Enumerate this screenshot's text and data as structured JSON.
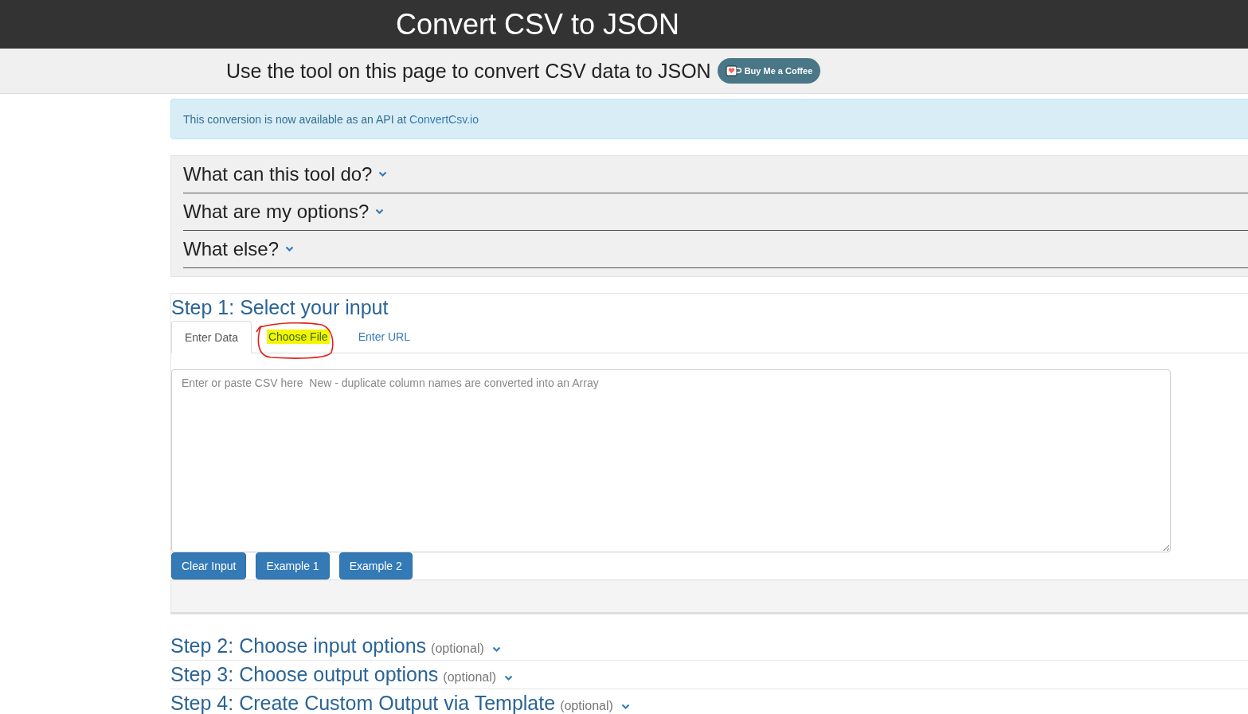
{
  "header": {
    "title": "Convert CSV to JSON"
  },
  "subheader": {
    "text": "Use the tool on this page to convert CSV data to JSON",
    "coffee_button": "Buy Me a Coffee"
  },
  "alert": {
    "text": "This conversion is now available as an API at",
    "link": "ConvertCsv.io"
  },
  "faq": [
    {
      "question": "What can this tool do?",
      "expanded": false
    },
    {
      "question": "What are my options?",
      "expanded": false
    },
    {
      "question": "What else?",
      "expanded": false
    }
  ],
  "step1": {
    "title": "Step 1: Select your input",
    "tabs": [
      {
        "label": "Enter Data",
        "selected": true,
        "highlighted": false
      },
      {
        "label": "Choose File",
        "selected": false,
        "highlighted": true
      },
      {
        "label": "Enter URL",
        "selected": false,
        "highlighted": false
      }
    ],
    "input": {
      "placeholder": "Enter or paste CSV here  New - duplicate column names are converted into an Array"
    },
    "buttons": [
      "Clear Input",
      "Example 1",
      "Example 2"
    ]
  },
  "steps": [
    {
      "title": "Step 2: Choose input options",
      "note": "(optional)",
      "expanded": false
    },
    {
      "title": "Step 3: Choose output options",
      "note": "(optional)",
      "expanded": false
    },
    {
      "title": "Step 4: Create Custom Output via Template",
      "note": "(optional)",
      "expanded": false
    }
  ]
}
